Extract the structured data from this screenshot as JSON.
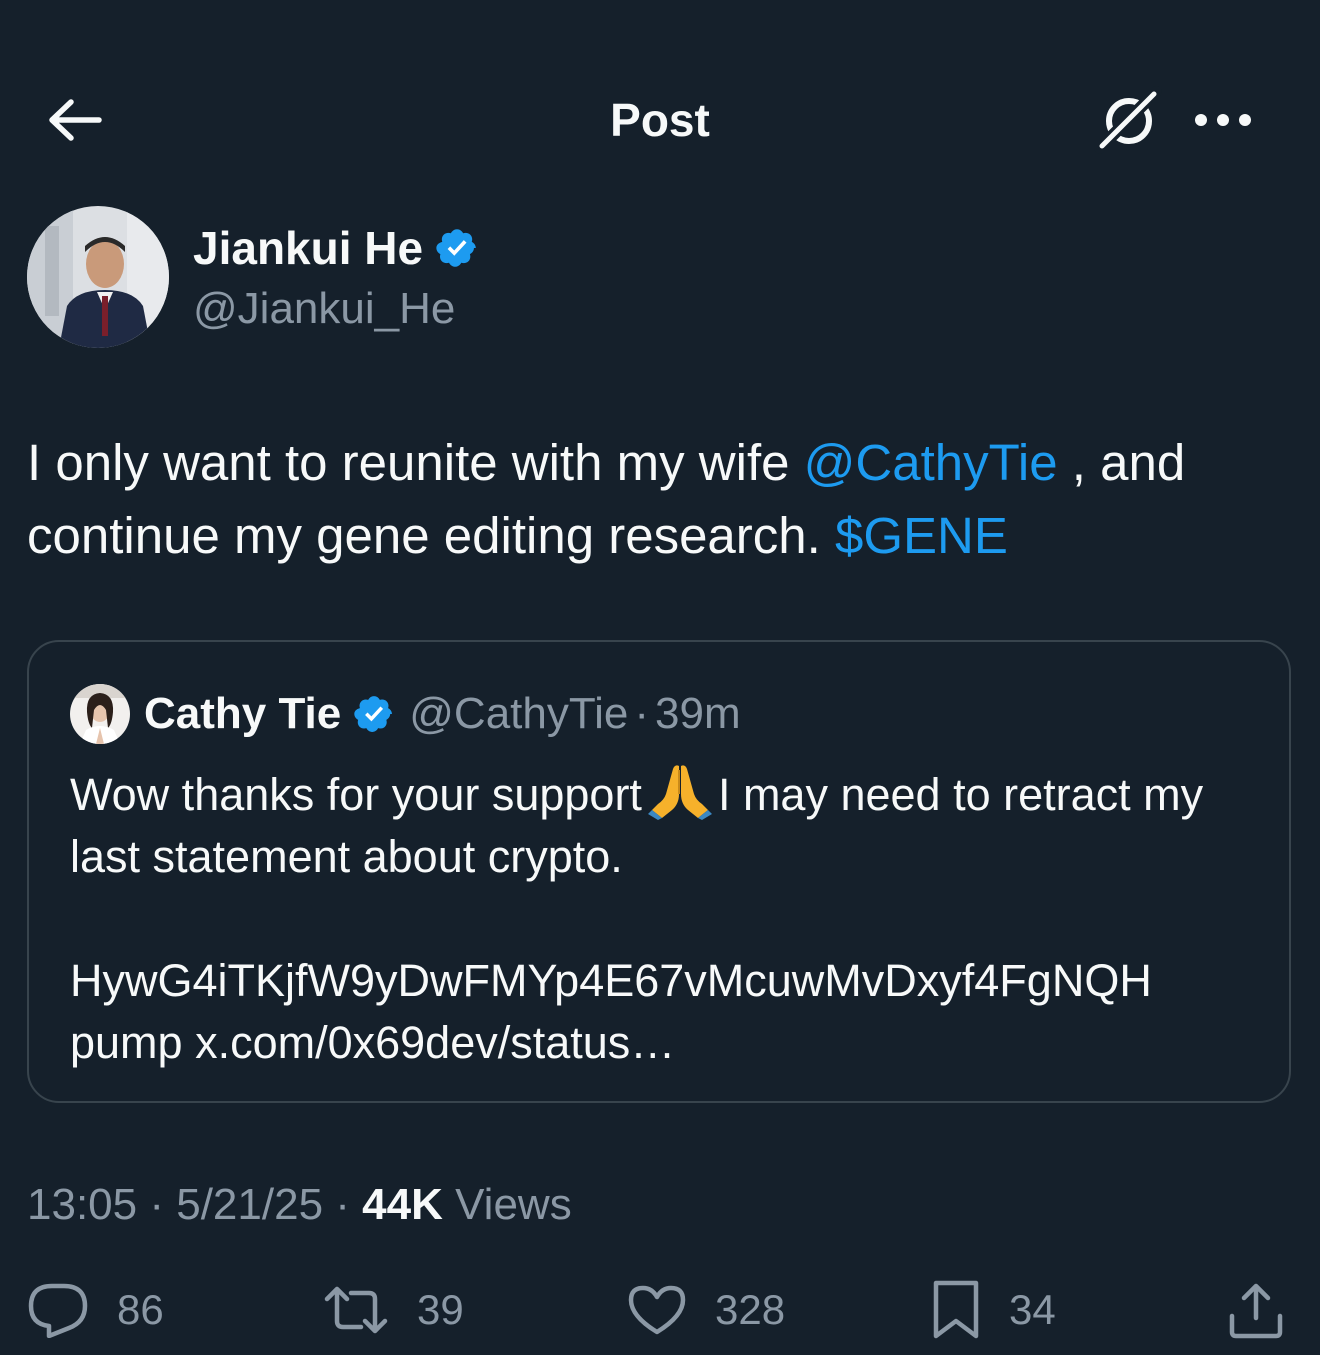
{
  "header": {
    "title": "Post"
  },
  "post": {
    "author": {
      "name": "Jiankui He",
      "handle": "@Jiankui_He"
    },
    "text": {
      "part1": "I only want to reunite with my wife ",
      "mention": "@CathyTie",
      "part2": " , and continue my gene editing research. ",
      "cashtag": "$GENE"
    },
    "quote": {
      "name": "Cathy Tie",
      "handle": "@CathyTie",
      "separator": "·",
      "time": "39m",
      "line1_before_emoji": "Wow thanks for your support",
      "line1_after_emoji": "I may need to retract my last statement about crypto.",
      "line2": "HywG4iTKjfW9yDwFMYp4E67vMcuwMvDxyf4FgNQH pump x.com/0x69dev/status…"
    },
    "meta": {
      "time": "13:05",
      "separator": "·",
      "date": "5/21/25",
      "views_count": "44K",
      "views_label": "Views"
    },
    "actions": {
      "replies": "86",
      "reposts": "39",
      "likes": "328",
      "bookmarks": "34"
    }
  },
  "colors": {
    "background": "#15202b",
    "accent": "#1d9bf0",
    "secondary_text": "#8b98a5",
    "border": "#38444d"
  }
}
